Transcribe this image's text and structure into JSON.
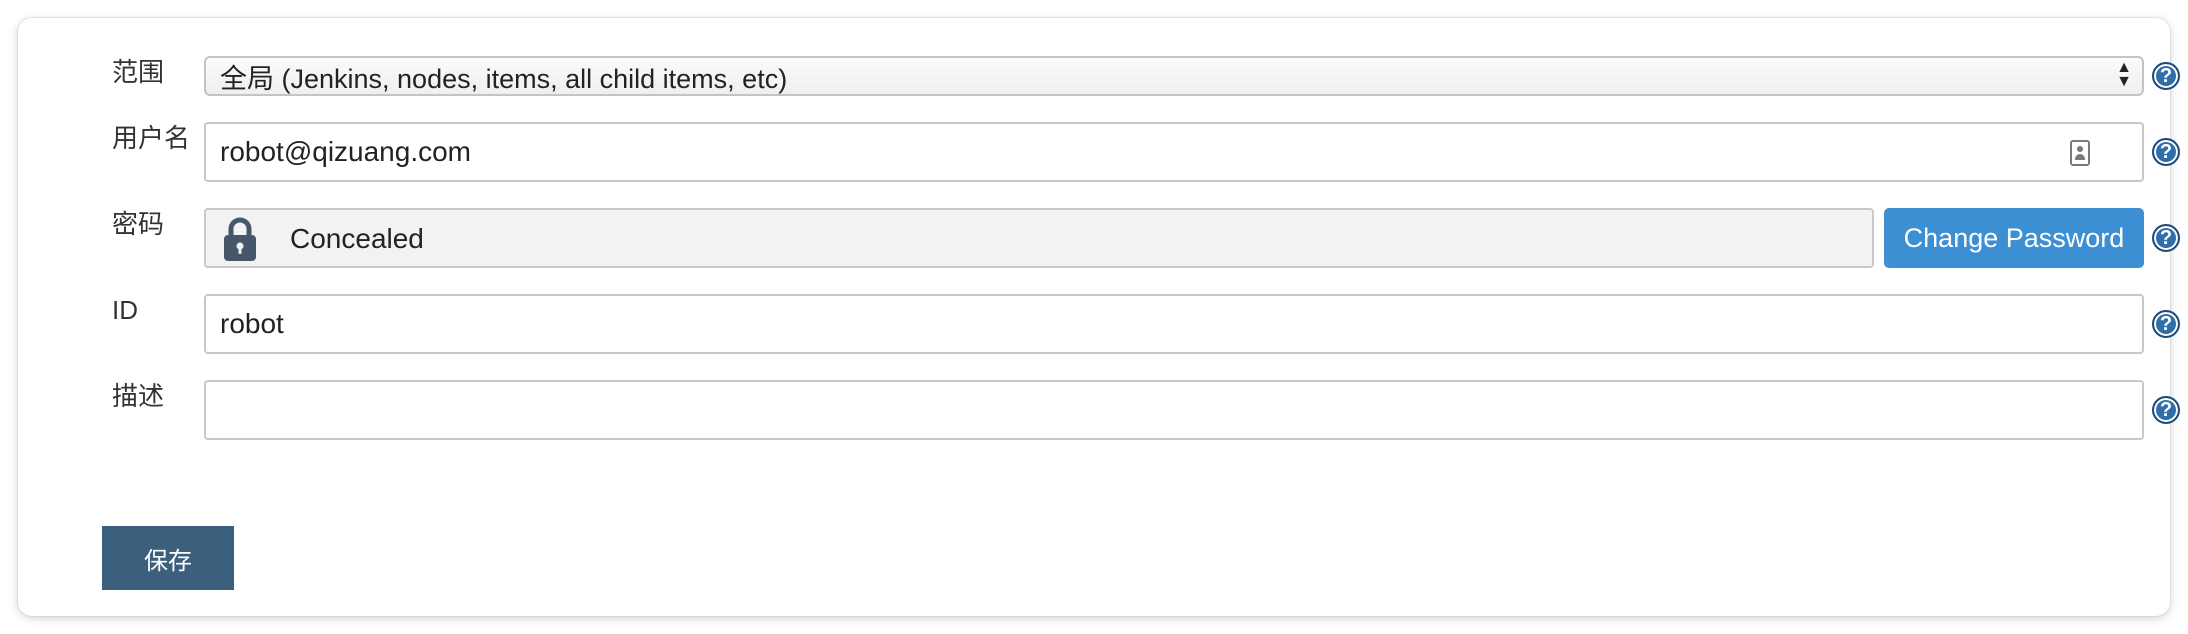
{
  "form": {
    "scope": {
      "label": "范围",
      "value": "全局 (Jenkins, nodes, items, all child items, etc)"
    },
    "username": {
      "label": "用户名",
      "value": "robot@qizuang.com"
    },
    "password": {
      "label": "密码",
      "value": "Concealed",
      "change_button": "Change Password"
    },
    "id": {
      "label": "ID",
      "value": "robot"
    },
    "description": {
      "label": "描述",
      "value": ""
    },
    "help_symbol": "?",
    "save_button": "保存"
  },
  "colors": {
    "primary_button": "#3d8fd3",
    "save_button": "#3b5f7d",
    "help_icon": "#2f6ea9"
  },
  "icons": {
    "lock": "lock-icon",
    "contact": "contact-card-icon",
    "help": "help-icon",
    "select_arrows": "up-down-arrows-icon"
  }
}
